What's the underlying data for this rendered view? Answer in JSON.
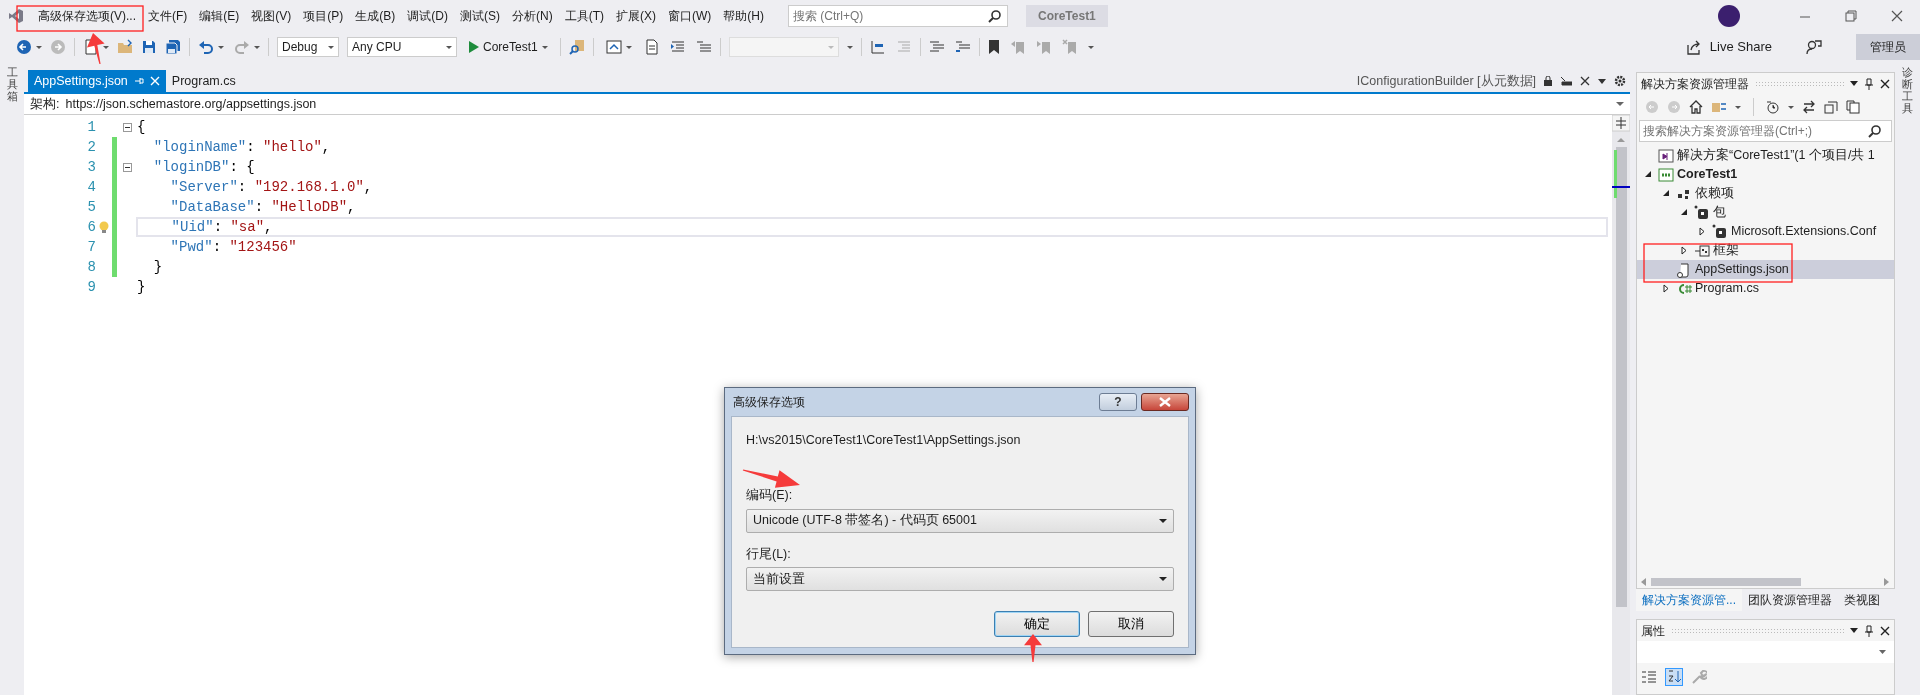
{
  "title_bar": {
    "menu": [
      "高级保存选项(V)...",
      "文件(F)",
      "编辑(E)",
      "视图(V)",
      "项目(P)",
      "生成(B)",
      "调试(D)",
      "测试(S)",
      "分析(N)",
      "工具(T)",
      "扩展(X)",
      "窗口(W)",
      "帮助(H)"
    ],
    "search": {
      "placeholder": "搜索 (Ctrl+Q)"
    },
    "solution_badge": "CoreTest1"
  },
  "toolbar": {
    "configuration": "Debug",
    "platform": "Any CPU",
    "start_button": "CoreTest1",
    "live_share": "Live Share",
    "admin_badge": "管理员"
  },
  "toolbox_strip": "工具箱",
  "document_tabs": [
    {
      "label": "AppSettings.json",
      "selected": true
    },
    {
      "label": "Program.cs",
      "selected": false
    }
  ],
  "metadata_tab": "IConfigurationBuilder [从元数据]",
  "schema_bar": {
    "label": "架构:",
    "url": "https://json.schemastore.org/appsettings.json"
  },
  "code_lines": [
    {
      "number": "1",
      "foldable": true,
      "changed": false,
      "current": false,
      "lightbulb": false,
      "tokens": [
        {
          "kind": "punct",
          "text": "{"
        }
      ]
    },
    {
      "number": "2",
      "foldable": false,
      "changed": true,
      "current": false,
      "lightbulb": false,
      "tokens": [
        {
          "kind": "key",
          "text": "  \"loginName\""
        },
        {
          "kind": "punct",
          "text": ": "
        },
        {
          "kind": "string",
          "text": "\"hello\""
        },
        {
          "kind": "punct",
          "text": ","
        }
      ]
    },
    {
      "number": "3",
      "foldable": true,
      "changed": true,
      "current": false,
      "lightbulb": false,
      "tokens": [
        {
          "kind": "key",
          "text": "  \"loginDB\""
        },
        {
          "kind": "punct",
          "text": ": {"
        }
      ]
    },
    {
      "number": "4",
      "foldable": false,
      "changed": true,
      "current": false,
      "lightbulb": false,
      "tokens": [
        {
          "kind": "key",
          "text": "    \"Server\""
        },
        {
          "kind": "punct",
          "text": ": "
        },
        {
          "kind": "string",
          "text": "\"192.168.1.0\""
        },
        {
          "kind": "punct",
          "text": ","
        }
      ]
    },
    {
      "number": "5",
      "foldable": false,
      "changed": true,
      "current": false,
      "lightbulb": false,
      "tokens": [
        {
          "kind": "key",
          "text": "    \"DataBase\""
        },
        {
          "kind": "punct",
          "text": ": "
        },
        {
          "kind": "string",
          "text": "\"HelloDB\""
        },
        {
          "kind": "punct",
          "text": ","
        }
      ]
    },
    {
      "number": "6",
      "foldable": false,
      "changed": true,
      "current": true,
      "lightbulb": true,
      "tokens": [
        {
          "kind": "key",
          "text": "    \"Uid\""
        },
        {
          "kind": "punct",
          "text": ": "
        },
        {
          "kind": "string",
          "text": "\"sa\""
        },
        {
          "kind": "punct",
          "text": ","
        }
      ]
    },
    {
      "number": "7",
      "foldable": false,
      "changed": true,
      "current": false,
      "lightbulb": false,
      "tokens": [
        {
          "kind": "key",
          "text": "    \"Pwd\""
        },
        {
          "kind": "punct",
          "text": ": "
        },
        {
          "kind": "string",
          "text": "\"123456\""
        }
      ]
    },
    {
      "number": "8",
      "foldable": false,
      "changed": true,
      "current": false,
      "lightbulb": false,
      "tokens": [
        {
          "kind": "punct",
          "text": "  }"
        }
      ]
    },
    {
      "number": "9",
      "foldable": false,
      "changed": false,
      "current": false,
      "lightbulb": false,
      "tokens": [
        {
          "kind": "punct",
          "text": "}"
        }
      ]
    }
  ],
  "solution_explorer": {
    "title": "解决方案资源管理器",
    "search": {
      "placeholder": "搜索解决方案资源管理器(Ctrl+;)"
    },
    "tree": [
      {
        "label": "解决方案“CoreTest1”(1 个项目/共 1",
        "kind": "solution",
        "expandable": false,
        "selected": false
      },
      {
        "label": "CoreTest1",
        "kind": "project",
        "expandable": true,
        "expanded": true,
        "selected": false,
        "children": [
          {
            "label": "依赖项",
            "kind": "dependencies",
            "expandable": true,
            "expanded": true,
            "selected": false,
            "children": [
              {
                "label": "包",
                "kind": "package",
                "expandable": true,
                "expanded": true,
                "selected": false,
                "children": [
                  {
                    "label": "Microsoft.Extensions.Conf",
                    "kind": "package",
                    "expandable": true,
                    "expanded": false,
                    "selected": false
                  }
                ]
              },
              {
                "label": "框架",
                "kind": "framework",
                "expandable": true,
                "expanded": false,
                "selected": false
              }
            ]
          },
          {
            "label": "AppSettings.json",
            "kind": "json",
            "expandable": false,
            "selected": true
          },
          {
            "label": "Program.cs",
            "kind": "csharp",
            "expandable": true,
            "expanded": false,
            "selected": false
          }
        ]
      }
    ],
    "tabs": [
      {
        "label": "解决方案资源管...",
        "selected": true
      },
      {
        "label": "团队资源管理器",
        "selected": false
      },
      {
        "label": "类视图",
        "selected": false
      }
    ]
  },
  "properties": {
    "title": "属性"
  },
  "diagnostics_strip": "诊断工具",
  "dialog": {
    "title": "高级保存选项",
    "help_button": "?",
    "path": "H:\\vs2015\\CoreTest1\\CoreTest1\\AppSettings.json",
    "fields": [
      {
        "label": "编码(E):",
        "value": "Unicode (UTF-8 带签名) - 代码页 65001"
      },
      {
        "label": "行尾(L):",
        "value": "当前设置"
      }
    ],
    "buttons": [
      {
        "label": "确定",
        "default": true
      },
      {
        "label": "取消",
        "default": false
      }
    ]
  }
}
